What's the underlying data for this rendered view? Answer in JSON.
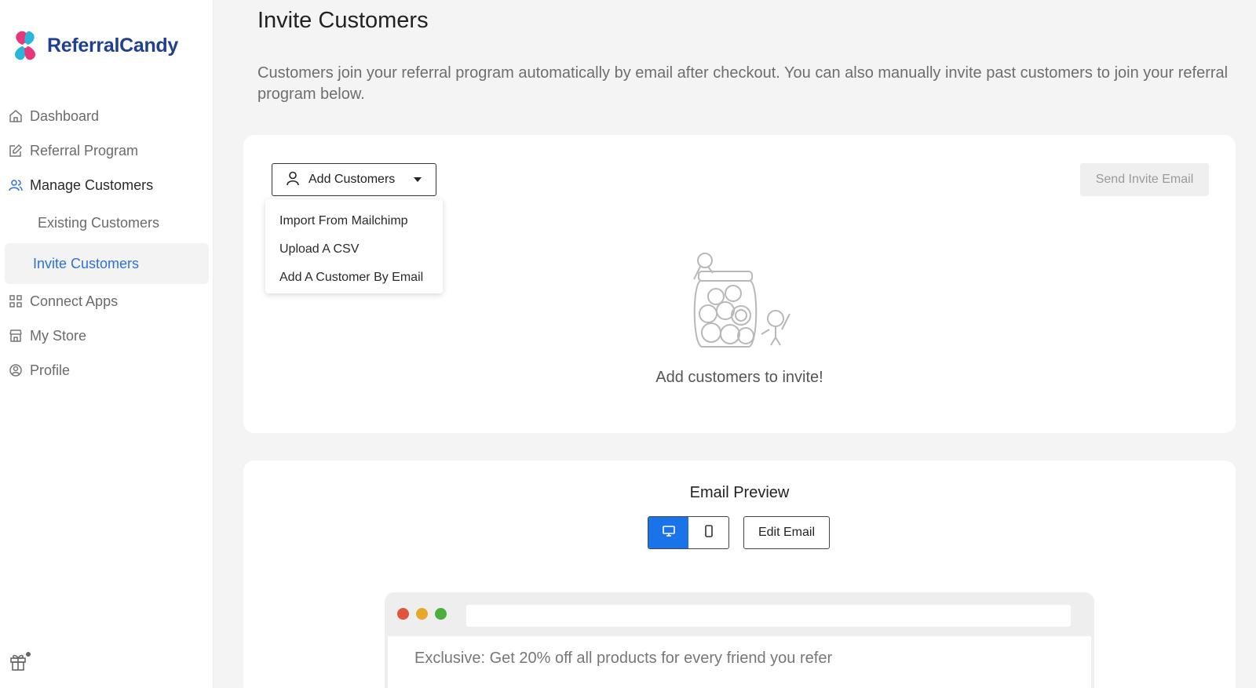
{
  "brand": {
    "name": "ReferralCandy"
  },
  "sidebar": {
    "items": [
      {
        "label": "Dashboard",
        "icon": "home-icon"
      },
      {
        "label": "Referral Program",
        "icon": "edit-icon"
      },
      {
        "label": "Manage Customers",
        "icon": "users-icon"
      },
      {
        "label": "Connect Apps",
        "icon": "grid-icon"
      },
      {
        "label": "My Store",
        "icon": "store-icon"
      },
      {
        "label": "Profile",
        "icon": "profile-icon"
      }
    ],
    "sub_items": [
      {
        "label": "Existing Customers"
      },
      {
        "label": "Invite Customers",
        "selected": true
      }
    ],
    "footer_icon": "gift-icon"
  },
  "page": {
    "title": "Invite Customers",
    "description": "Customers join your referral program automatically by email after checkout. You can also manually invite past customers to join your referral program below."
  },
  "invite_card": {
    "add_button_label": "Add Customers",
    "dropdown": [
      "Import From Mailchimp",
      "Upload A CSV",
      "Add A Customer By Email"
    ],
    "send_button_label": "Send Invite Email",
    "empty_text": "Add customers to invite!"
  },
  "preview_card": {
    "title": "Email Preview",
    "view_modes": [
      "desktop-icon",
      "mobile-icon"
    ],
    "active_mode": "desktop",
    "edit_button_label": "Edit Email",
    "email_subject": "Exclusive: Get 20% off all products for every friend you refer"
  },
  "colors": {
    "brand_blue": "#1f3f8f",
    "accent_blue": "#1a73e8",
    "dot_red": "#e0533c",
    "dot_yellow": "#e6a82c",
    "dot_green": "#4cae3f"
  }
}
